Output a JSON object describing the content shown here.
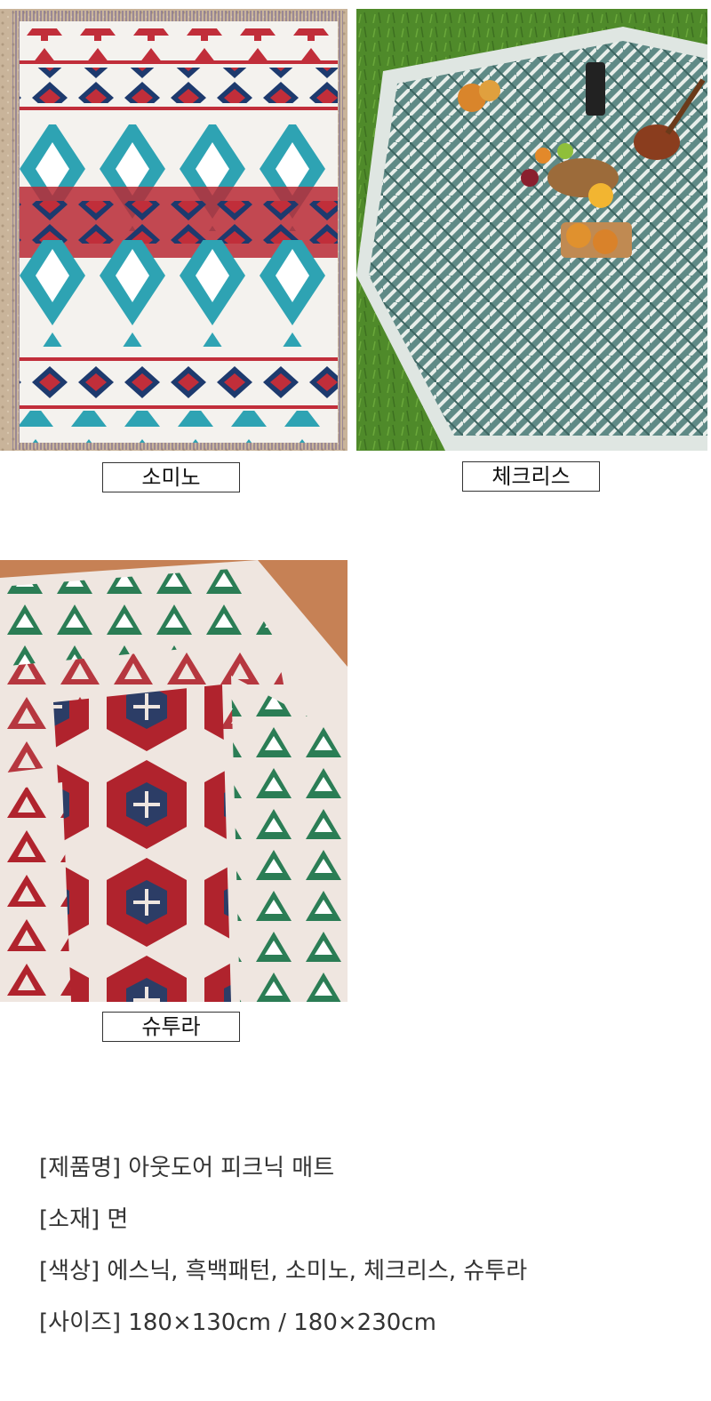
{
  "products": [
    {
      "name": "소미노"
    },
    {
      "name": "체크리스"
    },
    {
      "name": "슈투라"
    }
  ],
  "specs": {
    "product_name": "[제품명] 아웃도어 피크닉 매트",
    "material": "[소재] 면",
    "colors": "[색상] 에스닉, 흑백패턴, 소미노, 체크리스, 슈투라",
    "size": "[사이즈] 180×130cm / 180×230cm"
  }
}
